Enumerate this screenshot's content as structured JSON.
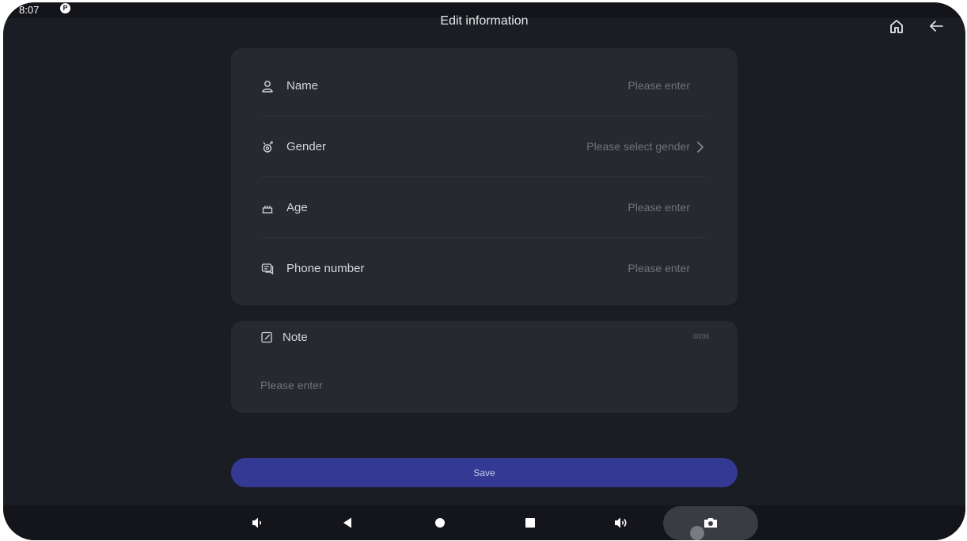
{
  "status_bar": {
    "time": "8:07",
    "notification_icon": "circle-p-icon"
  },
  "header": {
    "title": "Edit information",
    "home_icon": "home-icon",
    "back_icon": "arrow-left-icon"
  },
  "form": {
    "rows": [
      {
        "label": "Name",
        "placeholder": "Please enter",
        "icon": "person-icon"
      },
      {
        "label": "Gender",
        "placeholder": "Please select gender",
        "icon": "gender-icon"
      },
      {
        "label": "Age",
        "placeholder": "Please enter",
        "icon": "cake-icon"
      },
      {
        "label": "Phone number",
        "placeholder": "Please enter",
        "icon": "chat-icon"
      }
    ]
  },
  "note": {
    "label": "Note",
    "counter": "0/200",
    "placeholder": "Please enter",
    "icon": "edit-icon"
  },
  "actions": {
    "save_label": "Save"
  },
  "nav_bar": {
    "buttons": [
      "volume-down-icon",
      "back-triangle-icon",
      "home-circle-icon",
      "recents-square-icon",
      "volume-up-icon",
      "camera-icon"
    ]
  },
  "colors": {
    "background": "#1b1d24",
    "card": "#272930",
    "accent": "#343a94",
    "text_primary": "#d4d6db",
    "text_placeholder": "#6f7279"
  }
}
